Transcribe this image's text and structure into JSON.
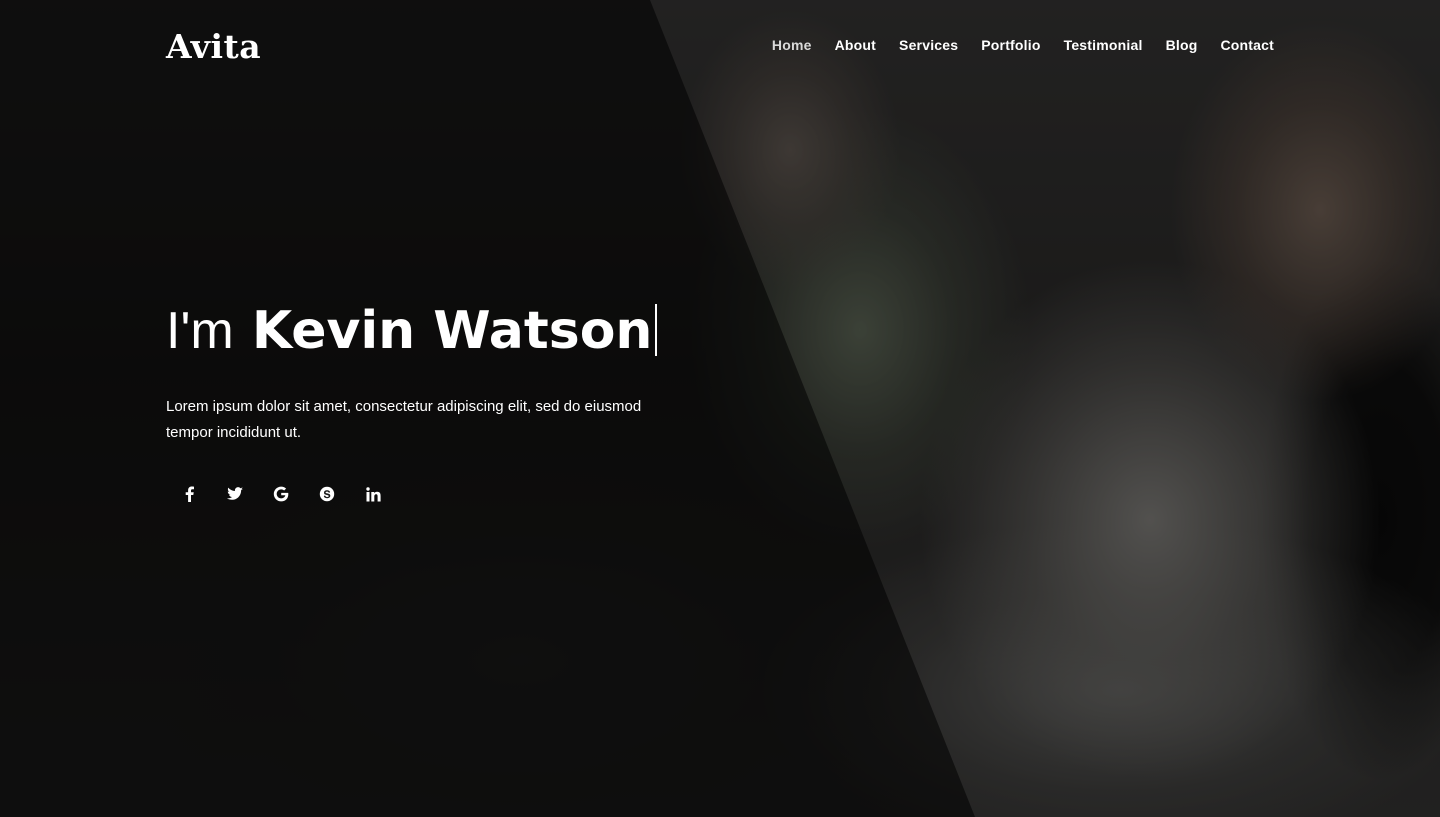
{
  "brand": {
    "logo": "Avita"
  },
  "nav": {
    "items": [
      {
        "label": "Home",
        "active": true
      },
      {
        "label": "About"
      },
      {
        "label": "Services"
      },
      {
        "label": "Portfolio"
      },
      {
        "label": "Testimonial"
      },
      {
        "label": "Blog"
      },
      {
        "label": "Contact"
      }
    ]
  },
  "hero": {
    "greeting": "I'm",
    "name": "Kevin Watson",
    "intro": "Lorem ipsum dolor sit amet, consectetur adipiscing elit, sed do eiusmod tempor incididunt ut."
  },
  "social": {
    "icons": [
      "facebook-icon",
      "twitter-icon",
      "google-icon",
      "skype-icon",
      "linkedin-icon"
    ]
  },
  "colors": {
    "text": "#ffffff",
    "panel": "#000000"
  }
}
